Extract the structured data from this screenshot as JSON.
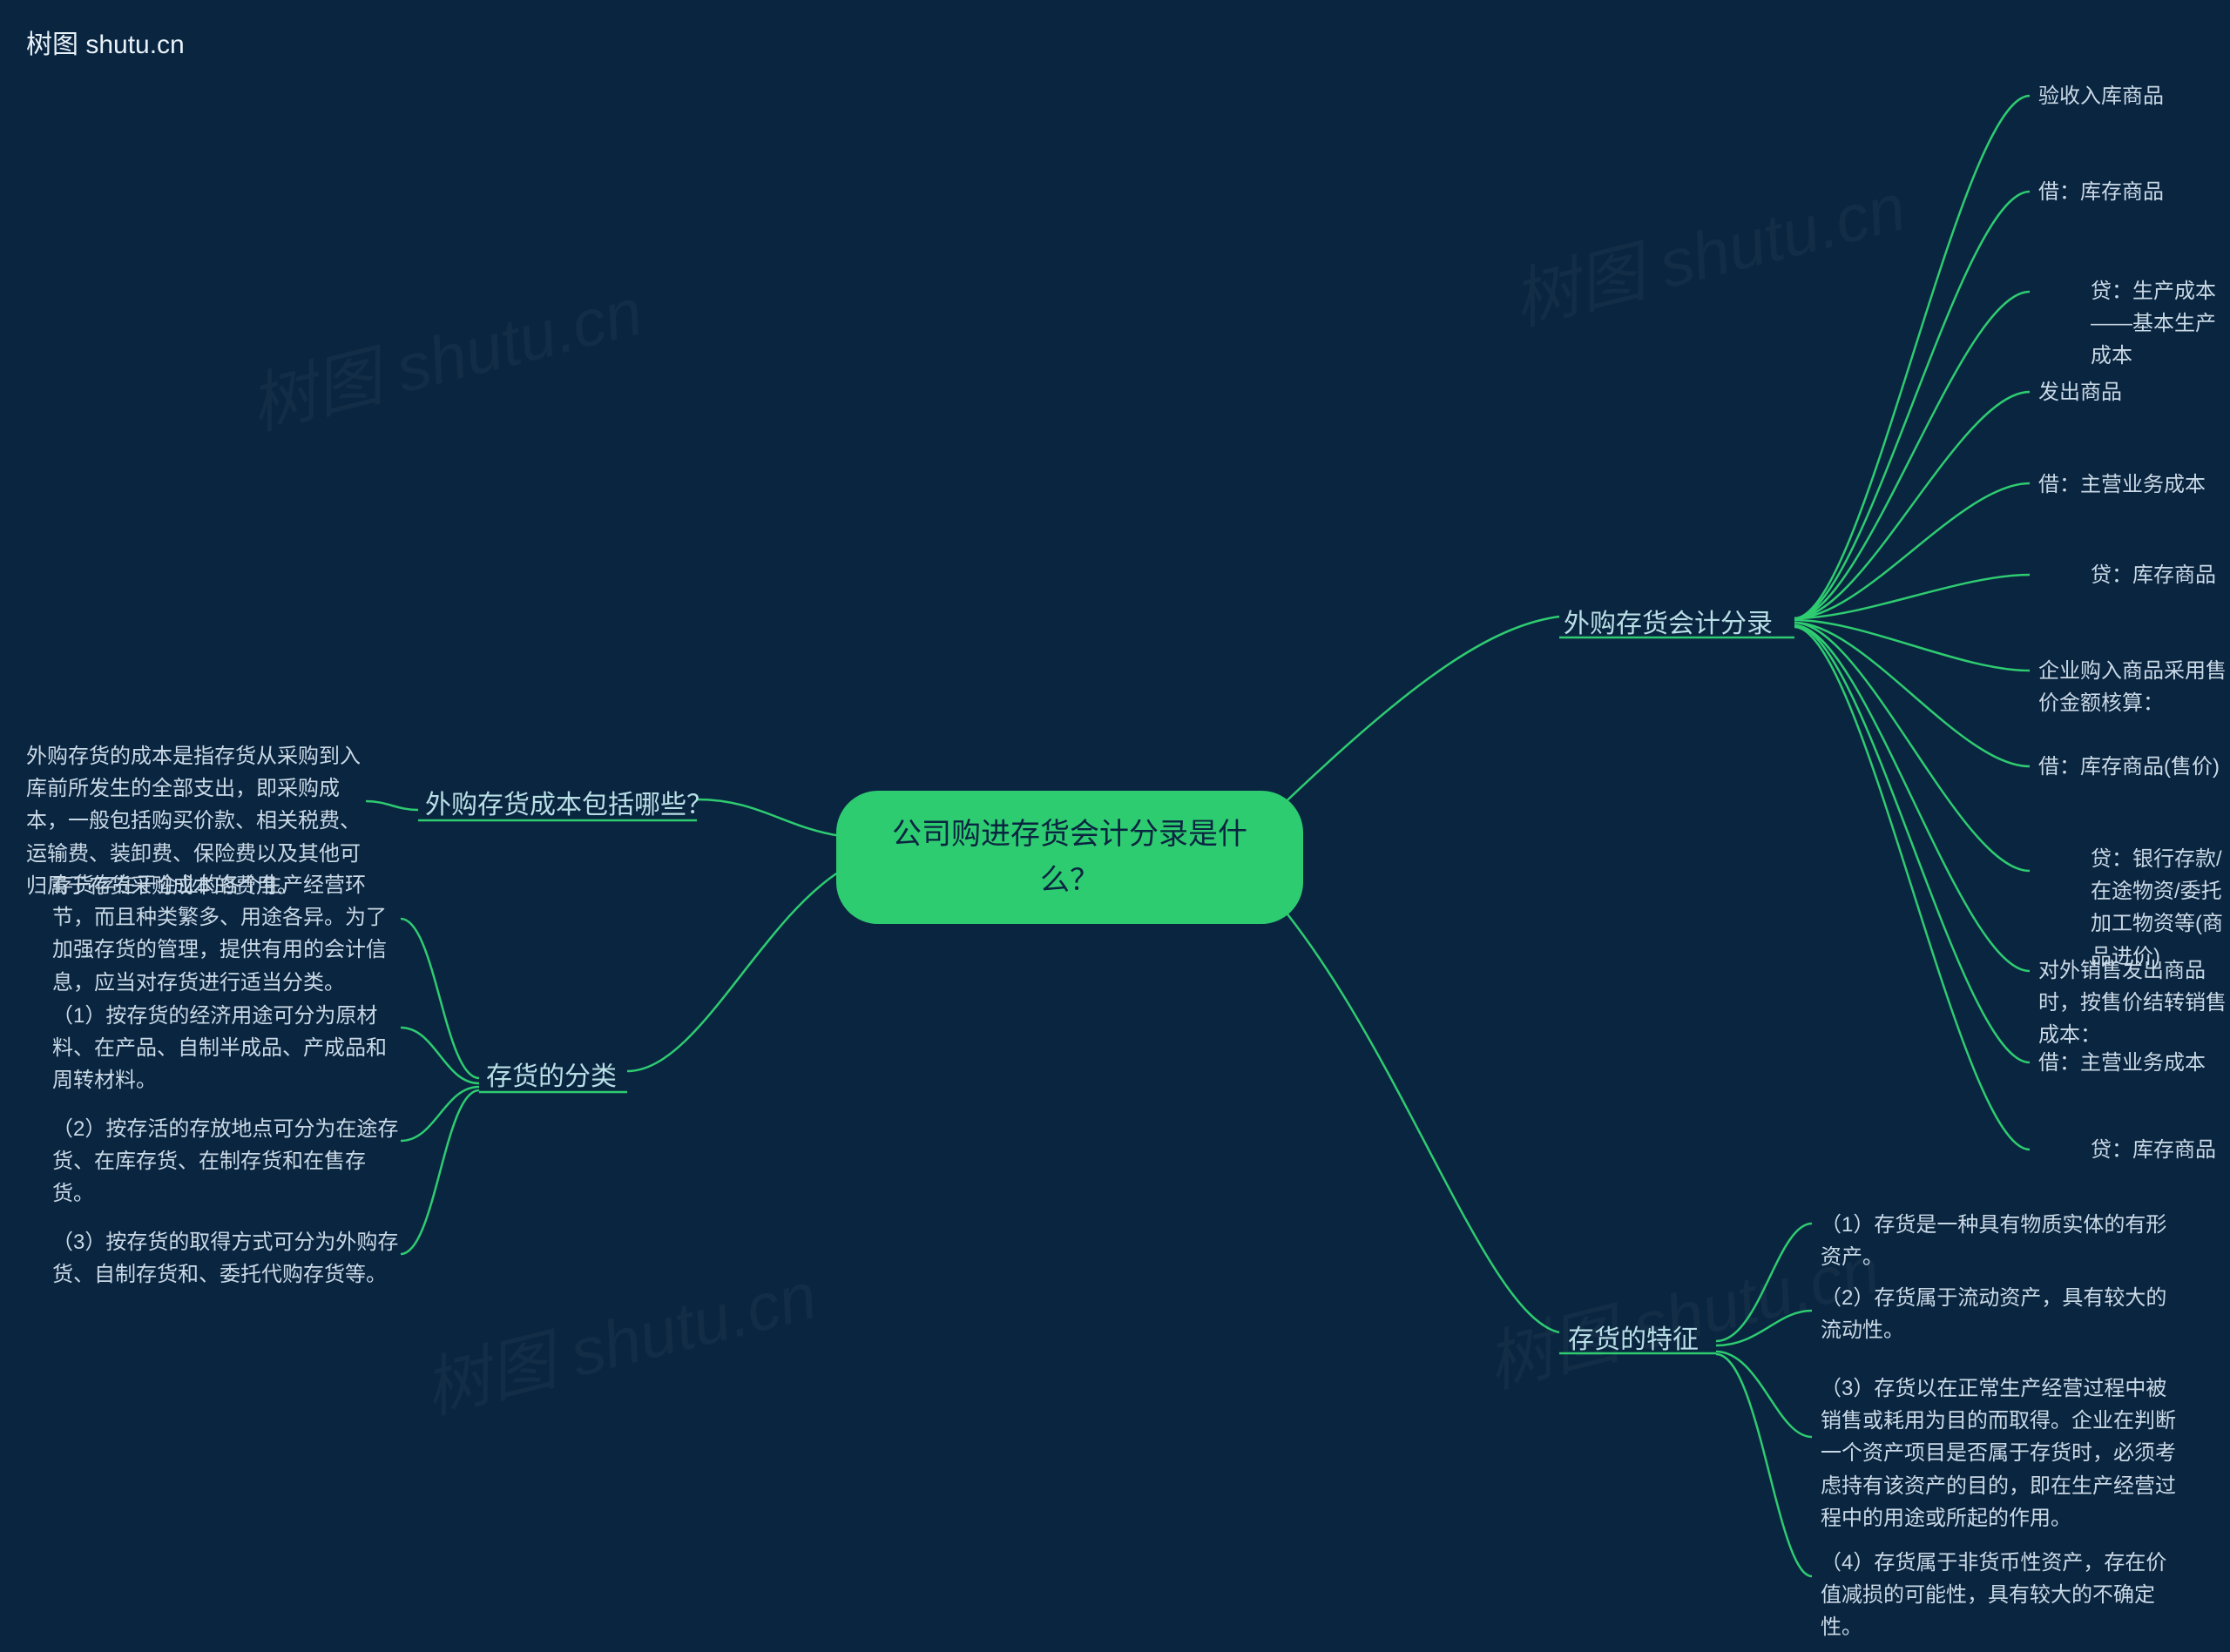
{
  "watermark_text": "树图 shutu.cn",
  "corner_label": "树图 shutu.cn",
  "center": "公司购进存货会计分录是什么？",
  "branches": {
    "b1": {
      "label": "外购存货会计分录",
      "leaves": [
        "验收入库商品",
        "借：库存商品",
        "贷：生产成本——基本生产成本",
        "发出商品",
        "借：主营业务成本",
        "贷：库存商品",
        "企业购入商品采用售价金额核算：",
        "借：库存商品(售价)",
        "贷：银行存款/在途物资/委托加工物资等(商品进价)",
        "对外销售发出商品时，按售价结转销售成本：",
        "借：主营业务成本",
        "贷：库存商品"
      ]
    },
    "b2": {
      "label": "存货的特征",
      "leaves": [
        "（1）存货是一种具有物质实体的有形资产。",
        "（2）存货属于流动资产，具有较大的流动性。",
        "（3）存货以在正常生产经营过程中被销售或耗用为目的而取得。企业在判断一个资产项目是否属于存货时，必须考虑持有该资产的目的，即在生产经营过程中的用途或所起的作用。",
        "（4）存货属于非货币性资产，存在价值减损的可能性，具有较大的不确定性。"
      ]
    },
    "b3": {
      "label": "外购存货成本包括哪些？",
      "leaves": [
        "外购存货的成本是指存货从采购到入库前所发生的全部支出，即采购成本，一般包括购买价款、相关税费、运输费、装卸费、保险费以及其他可归属于存货采购成本的费用。"
      ]
    },
    "b4": {
      "label": "存货的分类",
      "leaves": [
        "存货存在于企业的各个生产经营环节，而且种类繁多、用途各异。为了加强存货的管理，提供有用的会计信息，应当对存货进行适当分类。",
        "（1）按存货的经济用途可分为原材料、在产品、自制半成品、产成品和周转材料。",
        "（2）按存活的存放地点可分为在途存货、在库存货、在制存货和在售存货。",
        "（3）按存货的取得方式可分为外购存货、自制存货和、委托代购存货等。"
      ]
    }
  }
}
